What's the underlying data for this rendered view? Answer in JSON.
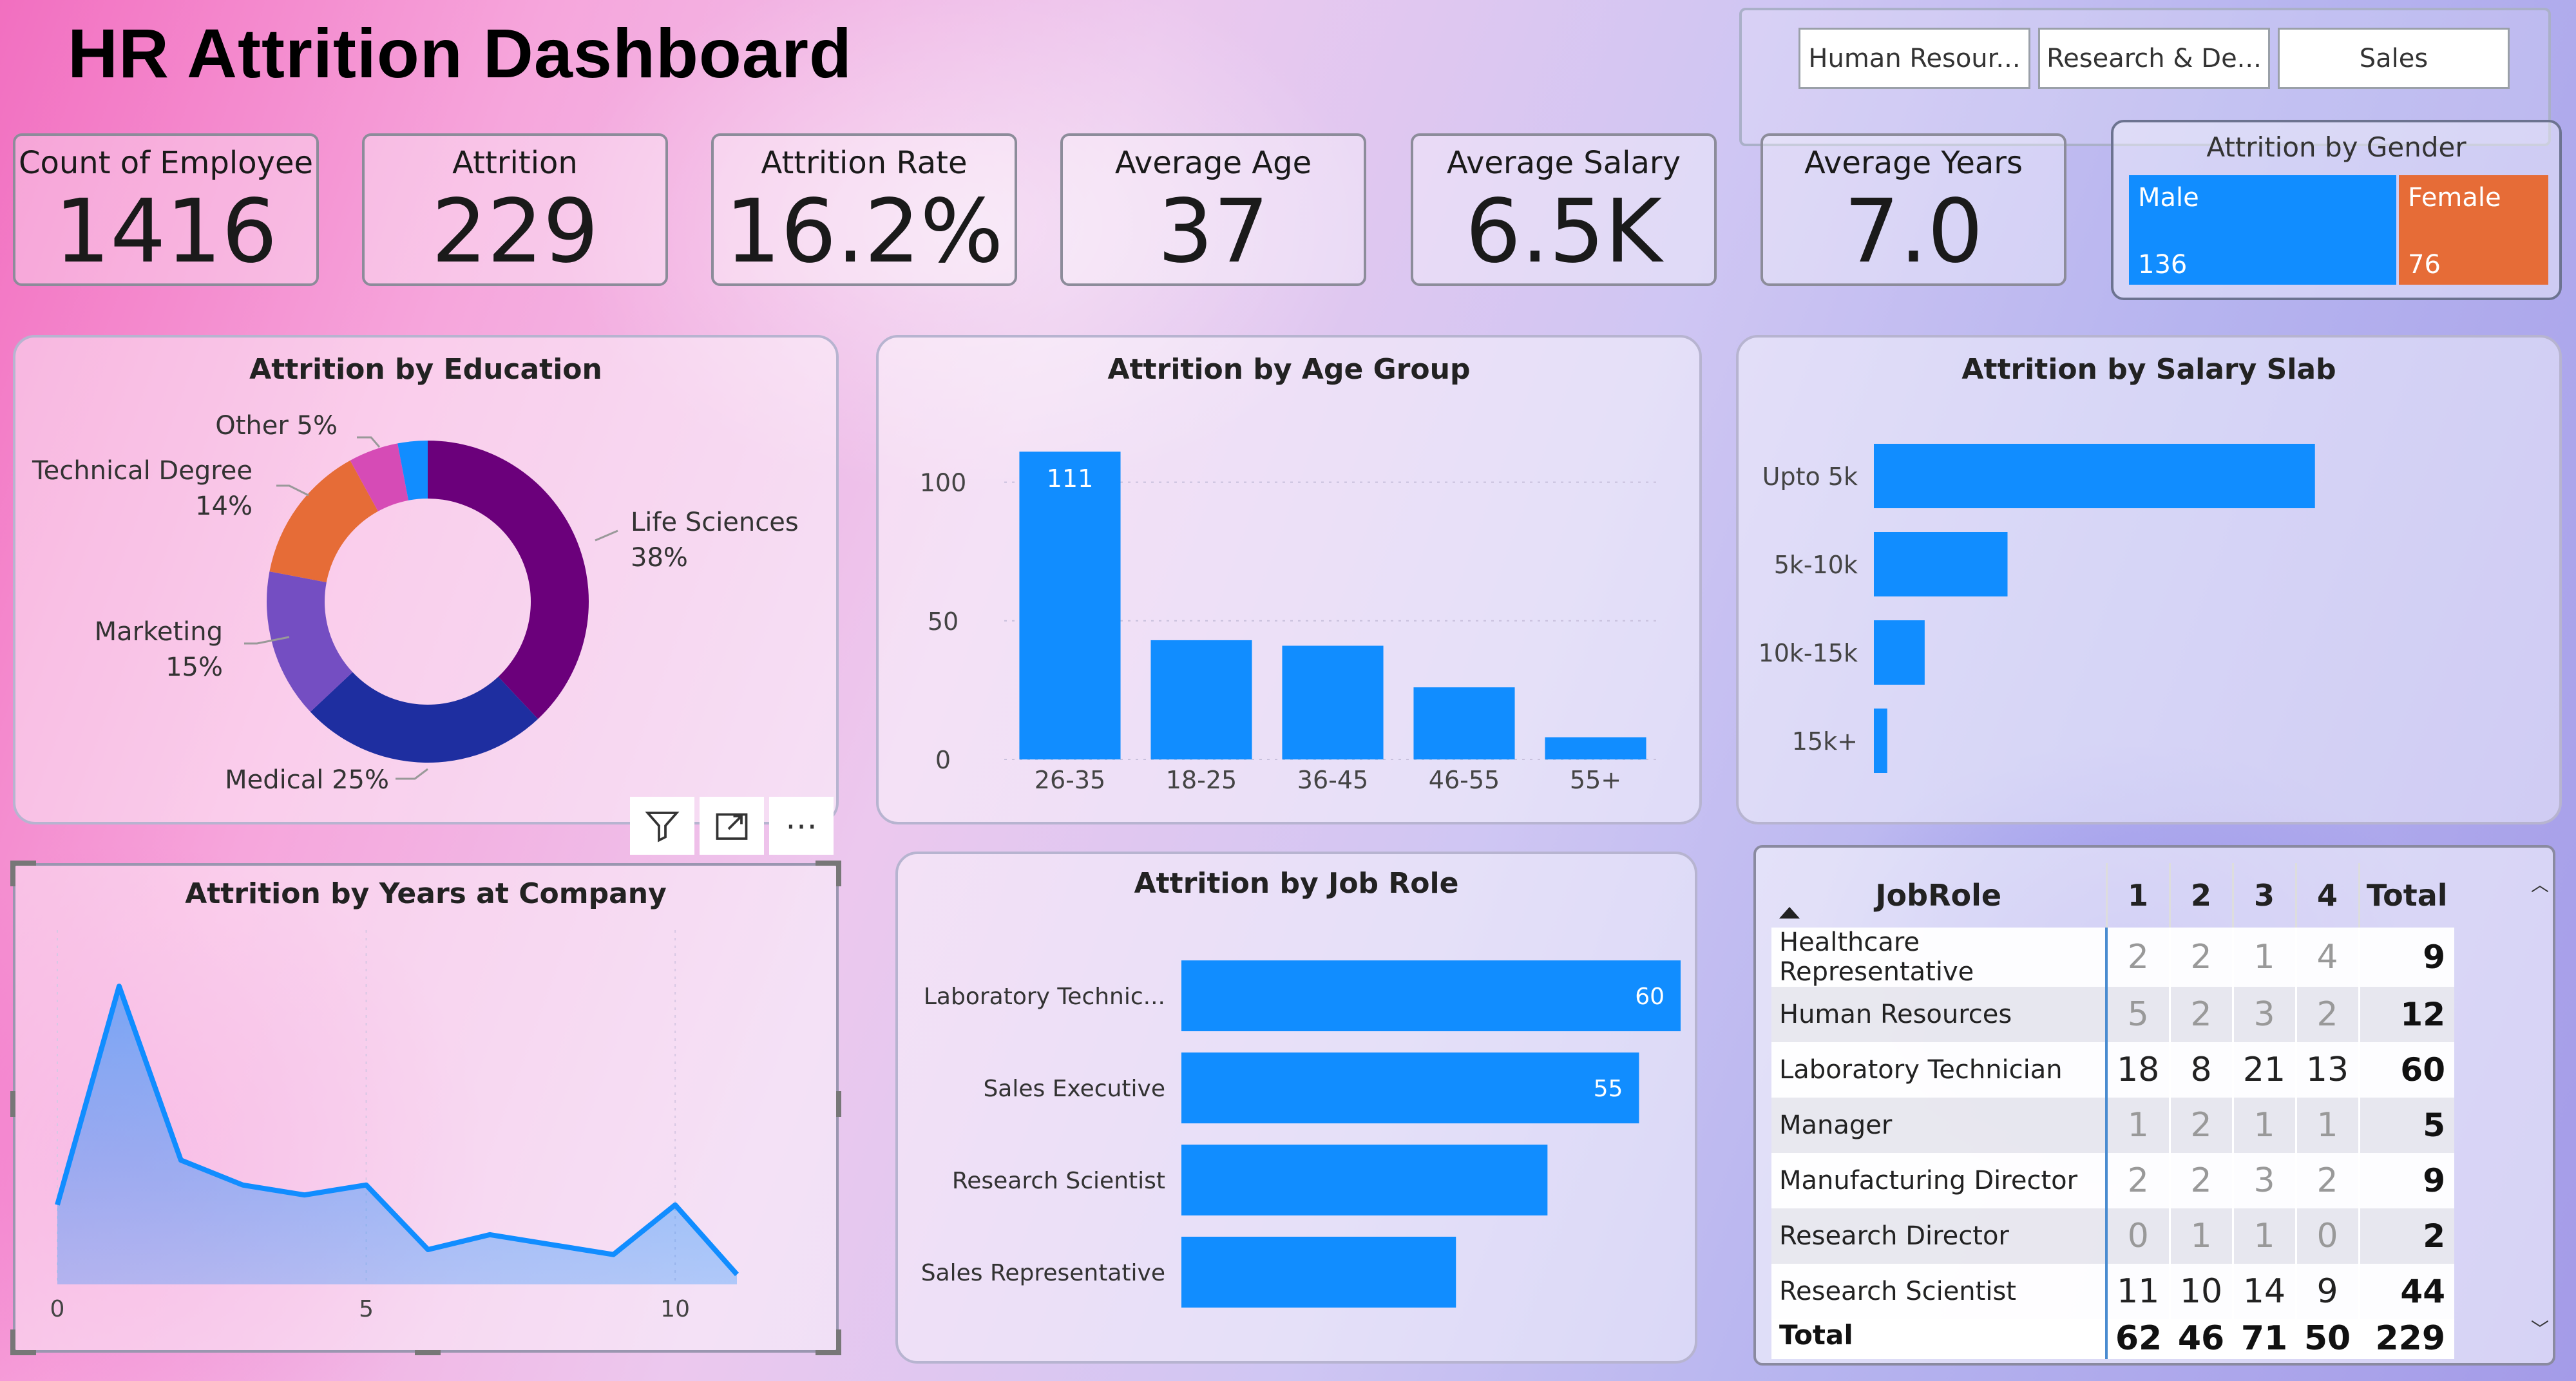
{
  "header": {
    "title": "HR Attrition Dashboard"
  },
  "slicer": {
    "items": [
      "Human Resour...",
      "Research & De...",
      "Sales"
    ]
  },
  "kpis": [
    {
      "label": "Count of Employee",
      "value": "1416"
    },
    {
      "label": "Attrition",
      "value": "229"
    },
    {
      "label": "Attrition Rate",
      "value": "16.2%"
    },
    {
      "label": "Average Age",
      "value": "37"
    },
    {
      "label": "Average Salary",
      "value": "6.5K"
    },
    {
      "label": "Average Years",
      "value": "7.0"
    }
  ],
  "gender": {
    "title": "Attrition by Gender",
    "male": {
      "label": "Male",
      "value": "136",
      "color": "#118DFF"
    },
    "female": {
      "label": "Female",
      "value": "76",
      "color": "#E66C37"
    }
  },
  "education": {
    "chart_data": {
      "type": "pie",
      "title": "Attrition by Education",
      "slices": [
        {
          "name": "Life Sciences",
          "pct": 38,
          "color": "#6B007B"
        },
        {
          "name": "Medical",
          "pct": 25,
          "color": "#1E2EA0"
        },
        {
          "name": "Marketing",
          "pct": 15,
          "color": "#744EC2"
        },
        {
          "name": "Technical Degree",
          "pct": 14,
          "color": "#E66C37"
        },
        {
          "name": "Other",
          "pct": 5,
          "color": "#D64BB6"
        },
        {
          "name": "",
          "pct": 3,
          "color": "#118DFF"
        }
      ],
      "labels": {
        "life": "Life Sciences",
        "life_pct": "38%",
        "medical": "Medical 25%",
        "marketing": "Marketing",
        "marketing_pct": "15%",
        "technical": "Technical Degree",
        "technical_pct": "14%",
        "other": "Other 5%"
      }
    }
  },
  "agegroup": {
    "chart_data": {
      "type": "bar",
      "title": "Attrition by Age Group",
      "categories": [
        "26-35",
        "18-25",
        "36-45",
        "46-55",
        "55+"
      ],
      "values": [
        111,
        43,
        41,
        26,
        8
      ],
      "data_labels": [
        "111"
      ],
      "ylim": [
        0,
        115
      ],
      "yticks": [
        "0",
        "50",
        "100"
      ],
      "color": "#118DFF"
    }
  },
  "salary": {
    "chart_data": {
      "type": "bar",
      "title": "Attrition by Salary Slab",
      "categories": [
        "Upto 5k",
        "5k-10k",
        "10k-15k",
        "15k+"
      ],
      "values": [
        165,
        50,
        19,
        5
      ],
      "xlim": [
        0,
        200
      ],
      "color": "#118DFF"
    }
  },
  "years": {
    "chart_data": {
      "type": "area",
      "title": "Attrition by Years at Company",
      "x": [
        0,
        1,
        2,
        3,
        4,
        5,
        6,
        7,
        8,
        9,
        10,
        11
      ],
      "values": [
        16,
        60,
        25,
        20,
        18,
        20,
        7,
        10,
        8,
        6,
        16,
        2
      ],
      "xticks": [
        "0",
        "5",
        "10"
      ],
      "ylim": [
        0,
        70
      ],
      "color": "#118DFF"
    }
  },
  "jobrole": {
    "chart_data": {
      "type": "bar",
      "title": "Attrition by Job Role",
      "categories": [
        "Laboratory Technic...",
        "Sales Executive",
        "Research Scientist",
        "Sales Representative"
      ],
      "values": [
        60,
        55,
        44,
        33
      ],
      "data_labels": [
        "60",
        "55"
      ],
      "xlim": [
        0,
        60
      ],
      "color": "#118DFF"
    }
  },
  "table": {
    "headers": [
      "JobRole",
      "1",
      "2",
      "3",
      "4",
      "Total"
    ],
    "rows": [
      [
        "Healthcare Representative",
        "2",
        "2",
        "1",
        "4",
        "9"
      ],
      [
        "Human Resources",
        "5",
        "2",
        "3",
        "2",
        "12"
      ],
      [
        "Laboratory Technician",
        "18",
        "8",
        "21",
        "13",
        "60"
      ],
      [
        "Manager",
        "1",
        "2",
        "1",
        "1",
        "5"
      ],
      [
        "Manufacturing Director",
        "2",
        "2",
        "3",
        "2",
        "9"
      ],
      [
        "Research Director",
        "0",
        "1",
        "1",
        "0",
        "2"
      ],
      [
        "Research Scientist",
        "11",
        "10",
        "14",
        "9",
        "44"
      ]
    ],
    "total": [
      "Total",
      "62",
      "46",
      "71",
      "50",
      "229"
    ]
  },
  "icons": {
    "filter": "filter-icon",
    "focus": "focus-mode-icon",
    "more": "more-options-icon"
  }
}
